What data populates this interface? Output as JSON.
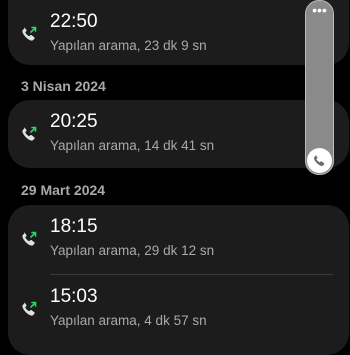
{
  "colors": {
    "background": "#000000",
    "card": "#1c1c1c",
    "outgoing_arrow": "#2fd36b",
    "handset": "#e0e0e0",
    "secondary_text": "#a9a9a9"
  },
  "calls": {
    "top": {
      "time": "22:50",
      "detail": "Yapılan arama, 23 dk 9 sn",
      "icon": "outgoing-call-icon"
    },
    "sections": [
      {
        "date": "3 Nisan 2024",
        "items": [
          {
            "time": "20:25",
            "detail": "Yapılan arama, 14 dk 41 sn",
            "icon": "outgoing-call-icon"
          }
        ]
      },
      {
        "date": "29 Mart 2024",
        "items": [
          {
            "time": "18:15",
            "detail": "Yapılan arama, 29 dk 12 sn",
            "icon": "outgoing-call-icon"
          },
          {
            "time": "15:03",
            "detail": "Yapılan arama, 4 dk 57 sn",
            "icon": "outgoing-call-icon"
          }
        ]
      }
    ]
  },
  "scrollbar": {
    "menu_glyph": "•••",
    "thumb_icon": "phone-icon"
  }
}
